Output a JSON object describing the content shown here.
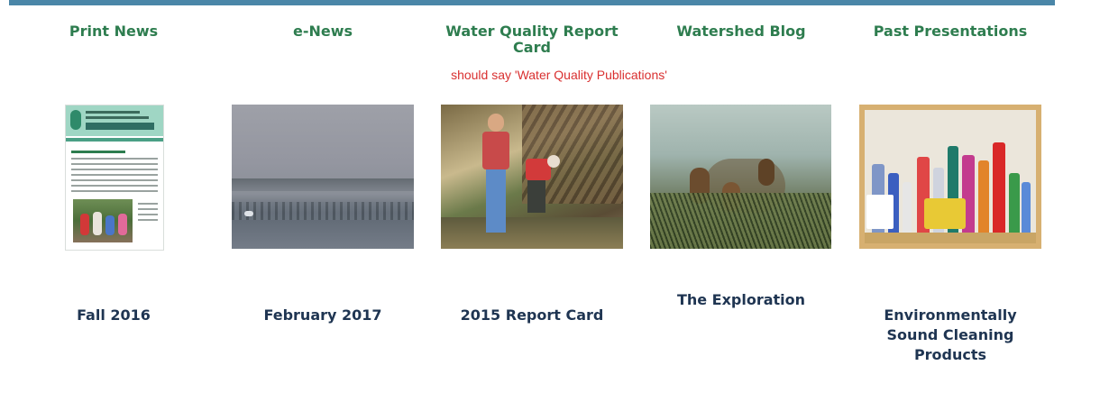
{
  "columns": [
    {
      "heading": "Print News",
      "caption": "Fall 2016",
      "thumbnail_icon": "newsletter-cover-image"
    },
    {
      "heading": "e-News",
      "caption": "February 2017",
      "thumbnail_icon": "foggy-marsh-image"
    },
    {
      "heading_line1": "Water Quality Report",
      "heading_line2": "Card",
      "caption": "2015 Report Card",
      "thumbnail_icon": "creek-sampling-image"
    },
    {
      "heading": "Watershed Blog",
      "caption": "The Exploration",
      "thumbnail_icon": "pine-cone-image"
    },
    {
      "heading": "Past Presentations",
      "caption_line1": "Environmentally",
      "caption_line2": "Sound Cleaning",
      "caption_line3": "Products",
      "thumbnail_icon": "cleaning-cabinet-image"
    }
  ],
  "note": "should say 'Water Quality Publications'",
  "colors": {
    "heading": "#2e7d4f",
    "caption": "#1f3552",
    "note": "#d93030",
    "top_bar": "#4a86a8"
  }
}
